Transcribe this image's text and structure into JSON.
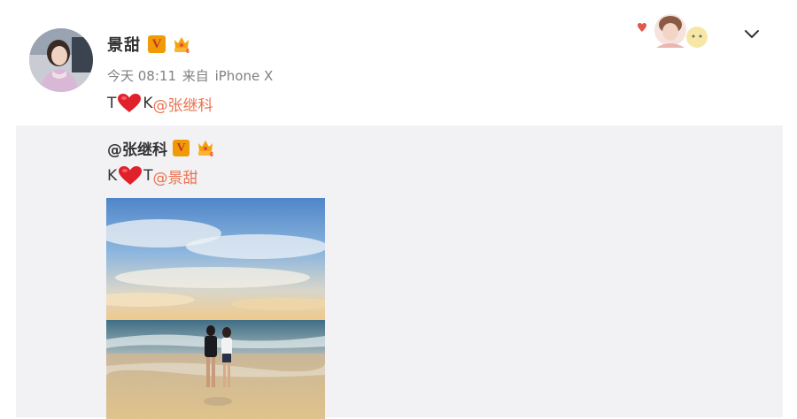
{
  "post": {
    "author": "景甜",
    "time": "今天 08:11",
    "source_prefix": "来自",
    "source": "iPhone X",
    "text_before": "T",
    "text_middle": "K",
    "mention": "@张继科"
  },
  "repost": {
    "author": "@张继科",
    "text_before": "K",
    "text_middle": "T",
    "mention": "@景甜"
  },
  "icons": {
    "verified": "verified-v-icon",
    "member": "member-crown-icon",
    "heart": "red-heart-icon",
    "dropdown": "chevron-down-icon"
  },
  "colors": {
    "mention": "#eb7350",
    "verified": "#f19a08",
    "repost_bg": "#f2f2f5"
  }
}
